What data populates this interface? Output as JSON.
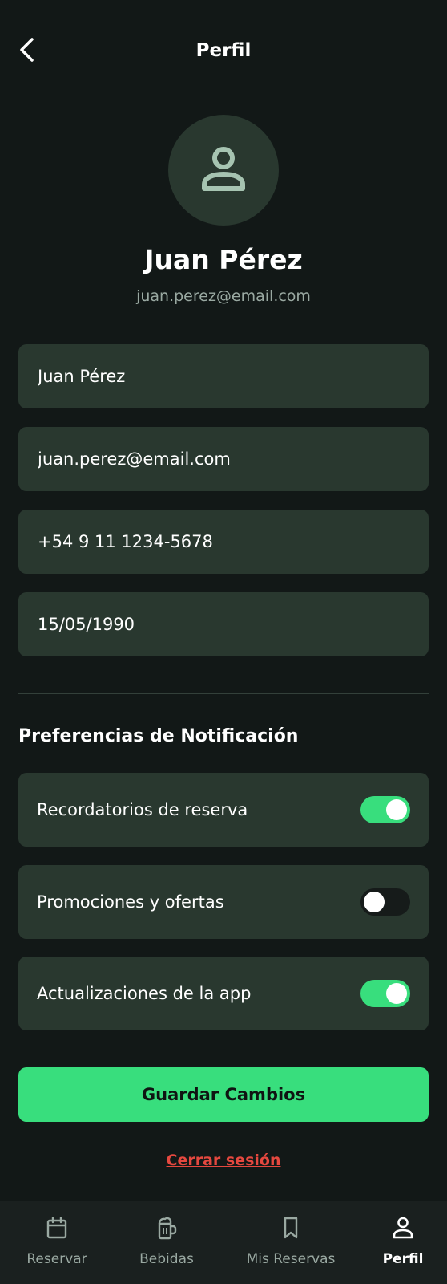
{
  "header": {
    "title": "Perfil"
  },
  "profile": {
    "name": "Juan Pérez",
    "email": "juan.perez@email.com"
  },
  "fields": [
    {
      "value": "Juan Pérez"
    },
    {
      "value": "juan.perez@email.com"
    },
    {
      "value": "+54 9 11 1234-5678"
    },
    {
      "value": "15/05/1990"
    }
  ],
  "notifications": {
    "title": "Preferencias de Notificación",
    "items": [
      {
        "label": "Recordatorios de reserva",
        "enabled": true
      },
      {
        "label": "Promociones y ofertas",
        "enabled": false
      },
      {
        "label": "Actualizaciones de la app",
        "enabled": true
      }
    ]
  },
  "actions": {
    "save_label": "Guardar Cambios",
    "logout_label": "Cerrar sesión"
  },
  "nav": {
    "items": [
      {
        "label": "Reservar",
        "icon": "calendar-icon",
        "active": false
      },
      {
        "label": "Bebidas",
        "icon": "beer-mug-icon",
        "active": false
      },
      {
        "label": "Mis Reservas",
        "icon": "bookmark-icon",
        "active": false
      },
      {
        "label": "Perfil",
        "icon": "person-icon",
        "active": true
      }
    ]
  },
  "colors": {
    "background": "#121817",
    "card": "#29382f",
    "accent": "#38de7d",
    "danger": "#e5483f",
    "muted_text": "#9aa9a2"
  }
}
